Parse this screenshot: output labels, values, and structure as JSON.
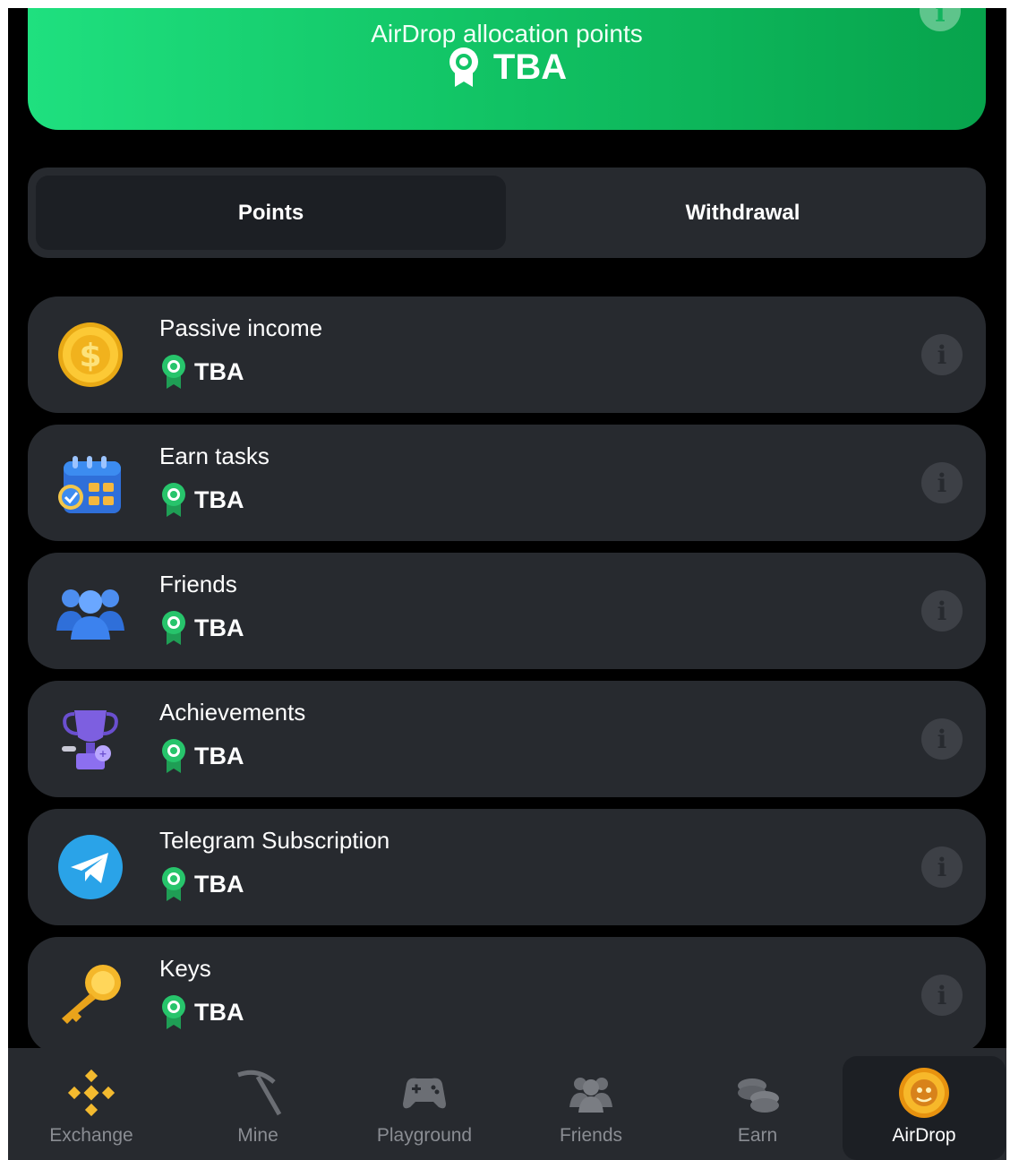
{
  "banner": {
    "title": "AirDrop allocation points",
    "value": "TBA",
    "info_glyph": "i"
  },
  "tabs": [
    {
      "label": "Points",
      "active": true
    },
    {
      "label": "Withdrawal",
      "active": false
    }
  ],
  "items": [
    {
      "title": "Passive income",
      "value": "TBA",
      "icon": "gold-coin-icon"
    },
    {
      "title": "Earn tasks",
      "value": "TBA",
      "icon": "calendar-tasks-icon"
    },
    {
      "title": "Friends",
      "value": "TBA",
      "icon": "friends-group-icon"
    },
    {
      "title": "Achievements",
      "value": "TBA",
      "icon": "trophy-icon"
    },
    {
      "title": "Telegram Subscription",
      "value": "TBA",
      "icon": "telegram-icon"
    },
    {
      "title": "Keys",
      "value": "TBA",
      "icon": "key-icon"
    }
  ],
  "nav": [
    {
      "label": "Exchange",
      "icon": "binance-icon",
      "active": false
    },
    {
      "label": "Mine",
      "icon": "pickaxe-icon",
      "active": false
    },
    {
      "label": "Playground",
      "icon": "gamepad-icon",
      "active": false
    },
    {
      "label": "Friends",
      "icon": "friends-icon",
      "active": false
    },
    {
      "label": "Earn",
      "icon": "coins-icon",
      "active": false
    },
    {
      "label": "AirDrop",
      "icon": "airdrop-coin-icon",
      "active": true
    }
  ],
  "colors": {
    "background": "#000000",
    "card": "#272a2f",
    "accent_green": "#12c566",
    "medal_green": "#27c46b",
    "text": "#ffffff",
    "muted": "#8a8d93"
  }
}
